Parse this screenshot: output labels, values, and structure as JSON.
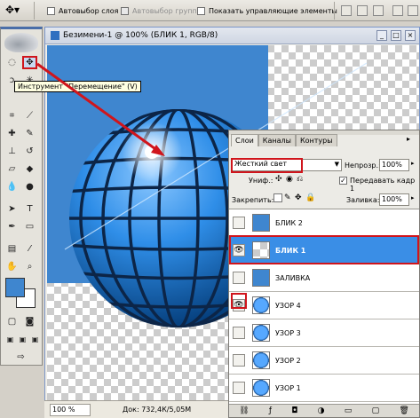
{
  "options_bar": {
    "auto_select_layer": "Автовыбор слоя",
    "auto_select_groups": "Автовыбор групп",
    "show_controls": "Показать управляющие элементы"
  },
  "document": {
    "title": "Безимени-1 @ 100% (БЛИК 1, RGB/8)",
    "zoom": "100 %",
    "doc_info": "Док: 732,4К/5,05М"
  },
  "tooltip": "Инструмент \"Перемещение\" (V)",
  "layers_panel": {
    "tabs": [
      "Слои",
      "Каналы",
      "Контуры"
    ],
    "blend_mode": "Жесткий свет",
    "opacity_label": "Непрозр.:",
    "opacity_value": "100%",
    "unify_label": "Униф.:",
    "propagate_label": "Передавать кадр 1",
    "lock_label": "Закрепить:",
    "fill_label": "Заливка:",
    "fill_value": "100%",
    "layers": [
      {
        "name": "БЛИК 2",
        "visible": false,
        "selected": false
      },
      {
        "name": "БЛИК 1",
        "visible": true,
        "selected": true
      },
      {
        "name": "ЗАЛИВКА",
        "visible": false,
        "selected": false
      },
      {
        "name": "УЗОР 4",
        "visible": true,
        "selected": false
      },
      {
        "name": "УЗОР 3",
        "visible": false,
        "selected": false
      },
      {
        "name": "УЗОР 2",
        "visible": false,
        "selected": false
      },
      {
        "name": "УЗОР 1",
        "visible": false,
        "selected": false
      }
    ]
  },
  "colors": {
    "accent_red": "#d0151c",
    "selection_blue": "#3a8ee6",
    "canvas_blue": "#3f86cf"
  }
}
